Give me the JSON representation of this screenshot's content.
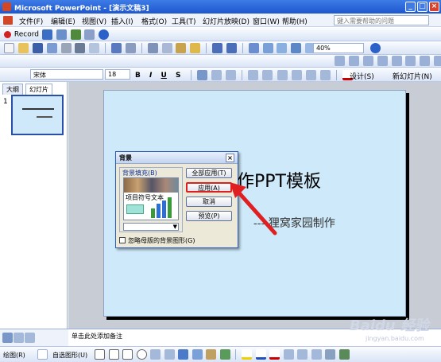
{
  "window": {
    "title": "Microsoft PowerPoint - [演示文稿3]"
  },
  "menubar": {
    "items": [
      "文件(F)",
      "编辑(E)",
      "视图(V)",
      "插入(I)",
      "格式(O)",
      "工具(T)",
      "幻灯片放映(D)",
      "窗口(W)",
      "帮助(H)"
    ],
    "help_placeholder": "键入需要帮助的问题"
  },
  "toolbar": {
    "record_label": "Record",
    "zoom": "40%",
    "font_name": "宋体",
    "font_size": "18",
    "bold": "B",
    "italic": "I",
    "underline": "U",
    "shadow": "S",
    "design_label": "设计(S)",
    "new_slide_label": "新幻灯片(N)"
  },
  "panel": {
    "tab_outline": "大纲",
    "tab_slides": "幻灯片",
    "slide_number": "1"
  },
  "slide": {
    "title_fragment": "作PPT模板",
    "subtitle": "----狸窝家园制作"
  },
  "dialog": {
    "title": "背景",
    "group_label": "背景填充(B)",
    "preview_text": "项目符号文本",
    "apply_all": "全部应用(T)",
    "apply": "应用(A)",
    "cancel": "取消",
    "preview": "预览(P)",
    "omit_checkbox": "忽略母版的背景图形(G)"
  },
  "notes": {
    "placeholder": "单击此处添加备注"
  },
  "drawing": {
    "draw_label": "绘图(R)",
    "autoshape_label": "自选图形(U)"
  },
  "watermark": {
    "text": "Baidu 经验",
    "url": "jingyan.baidu.com"
  },
  "colors": {
    "accent_red": "#e02020",
    "slide_bg": "#cde9fa"
  }
}
